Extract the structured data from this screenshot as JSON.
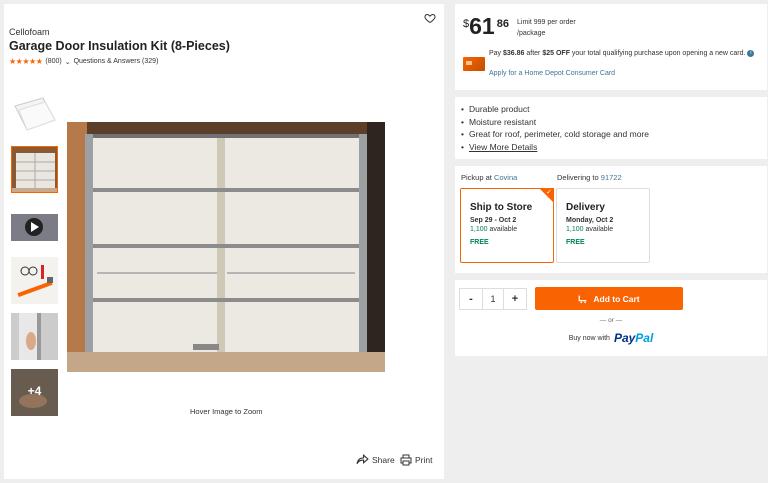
{
  "product": {
    "brand": "Cellofoam",
    "title": "Garage Door Insulation Kit (8-Pieces)",
    "rating_stars": "★★★★★",
    "review_count": "(800)",
    "qa_label": "Questions & Answers (329)"
  },
  "gallery": {
    "more_count": "+4",
    "hover_text": "Hover Image to Zoom",
    "share_label": "Share",
    "print_label": "Print"
  },
  "price": {
    "currency": "$",
    "dollars": "61",
    "cents": "86",
    "limit_line1": "Limit 999 per order",
    "limit_line2": "/package",
    "promo_pay": "Pay ",
    "promo_amount": "$36.86",
    "promo_after": " after ",
    "promo_off": "$25 OFF",
    "promo_rest": " your total qualifying purchase upon opening a new card.",
    "apply_link": "Apply for a Home Depot Consumer Card"
  },
  "features": {
    "items": [
      "Durable product",
      "Moisture resistant",
      "Great for roof, perimeter, cold storage and more"
    ],
    "more_link": "View More Details"
  },
  "fulfillment": {
    "pickup_prefix": "Pickup at ",
    "pickup_store": "Covina",
    "delivery_prefix": "Delivering to ",
    "delivery_zip": "91722",
    "ship": {
      "title": "Ship to Store",
      "date": "Sep 29 - Oct 2",
      "avail_num": "1,100",
      "avail_text": " available",
      "price": "FREE"
    },
    "delivery": {
      "title": "Delivery",
      "date": "Monday, Oct 2",
      "avail_num": "1,100",
      "avail_text": " available",
      "price": "FREE"
    }
  },
  "cart": {
    "minus": "-",
    "quantity": "1",
    "plus": "+",
    "add_label": "Add to Cart",
    "or_label": "— or —",
    "buy_now": "Buy now with",
    "paypal_a": "Pay",
    "paypal_b": "Pal"
  },
  "colors": {
    "accent": "#f96302",
    "link": "#3e7697",
    "free_green": "#00805f"
  }
}
